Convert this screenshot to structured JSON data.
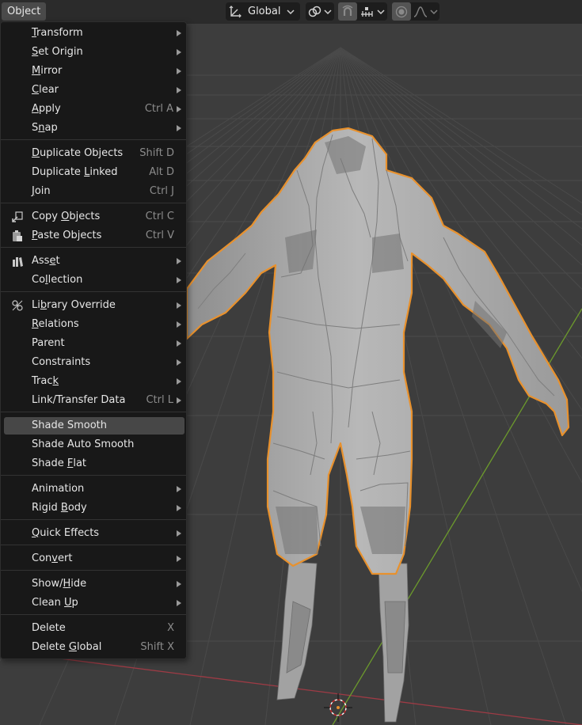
{
  "header": {
    "object_menu_label": "Object",
    "transform_orientation": "Global"
  },
  "menu": {
    "items": [
      {
        "label": "Transform",
        "mnemonic": "T",
        "shortcut": "",
        "submenu": true
      },
      {
        "label": "Set Origin",
        "mnemonic": "S",
        "shortcut": "",
        "submenu": true
      },
      {
        "label": "Mirror",
        "mnemonic": "M",
        "shortcut": "",
        "submenu": true
      },
      {
        "label": "Clear",
        "mnemonic": "C",
        "shortcut": "",
        "submenu": true
      },
      {
        "label": "Apply",
        "mnemonic": "A",
        "shortcut": "Ctrl A",
        "submenu": true
      },
      {
        "label": "Snap",
        "mnemonic": "n",
        "shortcut": "",
        "submenu": true
      },
      {
        "label": "Duplicate Objects",
        "mnemonic": "D",
        "shortcut": "Shift D",
        "submenu": false
      },
      {
        "label": "Duplicate Linked",
        "mnemonic": "L",
        "shortcut": "Alt D",
        "submenu": false
      },
      {
        "label": "Join",
        "mnemonic": "J",
        "shortcut": "Ctrl J",
        "submenu": false
      },
      {
        "label": "Copy Objects",
        "mnemonic": "O",
        "shortcut": "Ctrl C",
        "submenu": false,
        "icon": "copy-objects-icon"
      },
      {
        "label": "Paste Objects",
        "mnemonic": "P",
        "shortcut": "Ctrl V",
        "submenu": false,
        "icon": "paste-objects-icon"
      },
      {
        "label": "Asset",
        "mnemonic": "e",
        "shortcut": "",
        "submenu": true,
        "icon": "asset-icon"
      },
      {
        "label": "Collection",
        "mnemonic": "l",
        "shortcut": "",
        "submenu": true
      },
      {
        "label": "Library Override",
        "mnemonic": "b",
        "shortcut": "",
        "submenu": true,
        "icon": "library-override-icon"
      },
      {
        "label": "Relations",
        "mnemonic": "R",
        "shortcut": "",
        "submenu": true
      },
      {
        "label": "Parent",
        "mnemonic": "",
        "shortcut": "",
        "submenu": true
      },
      {
        "label": "Constraints",
        "mnemonic": "",
        "shortcut": "",
        "submenu": true
      },
      {
        "label": "Track",
        "mnemonic": "k",
        "shortcut": "",
        "submenu": true
      },
      {
        "label": "Link/Transfer Data",
        "mnemonic": "",
        "shortcut": "Ctrl L",
        "submenu": true
      },
      {
        "label": "Shade Smooth",
        "mnemonic": "",
        "shortcut": "",
        "submenu": false,
        "highlighted": true
      },
      {
        "label": "Shade Auto Smooth",
        "mnemonic": "",
        "shortcut": "",
        "submenu": false
      },
      {
        "label": "Shade Flat",
        "mnemonic": "F",
        "shortcut": "",
        "submenu": false
      },
      {
        "label": "Animation",
        "mnemonic": "",
        "shortcut": "",
        "submenu": true
      },
      {
        "label": "Rigid Body",
        "mnemonic": "B",
        "shortcut": "",
        "submenu": true
      },
      {
        "label": "Quick Effects",
        "mnemonic": "Q",
        "shortcut": "",
        "submenu": true
      },
      {
        "label": "Convert",
        "mnemonic": "v",
        "shortcut": "",
        "submenu": true
      },
      {
        "label": "Show/Hide",
        "mnemonic": "H",
        "shortcut": "",
        "submenu": true
      },
      {
        "label": "Clean Up",
        "mnemonic": "U",
        "shortcut": "",
        "submenu": true
      },
      {
        "label": "Delete",
        "mnemonic": "",
        "shortcut": "X",
        "submenu": false
      },
      {
        "label": "Delete Global",
        "mnemonic": "G",
        "shortcut": "Shift X",
        "submenu": false
      }
    ]
  },
  "colors": {
    "selection_outline": "#e8912d",
    "menu_background": "#181818",
    "menu_highlight": "#474747",
    "viewport_background": "#3d3d3d",
    "x_axis": "#9e3b45",
    "y_axis": "#6c9a2c"
  }
}
